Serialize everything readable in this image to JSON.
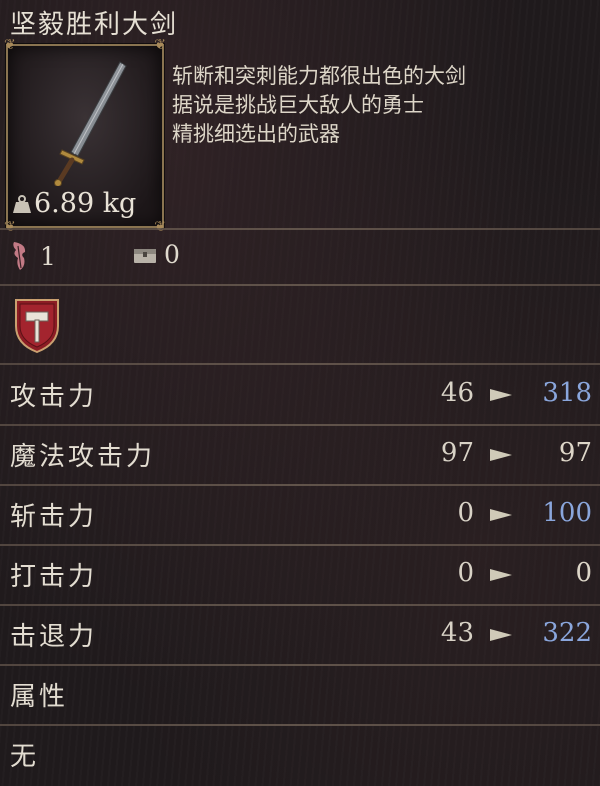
{
  "item": {
    "name": "坚毅胜利大剑",
    "weight": "6.89 kg",
    "description": [
      "斩断和突刺能力都很出色的大剑",
      "据说是挑战巨大敌人的勇士",
      "精挑细选出的武器"
    ]
  },
  "counts": {
    "held": "1",
    "stored": "0"
  },
  "stats": [
    {
      "label": "攻击力",
      "base": "46",
      "new": "318",
      "new_color": "#8aa6dc"
    },
    {
      "label": "魔法攻击力",
      "base": "97",
      "new": "97",
      "new_color": "#ddd6c8"
    },
    {
      "label": "斩击力",
      "base": "0",
      "new": "100",
      "new_color": "#8aa6dc"
    },
    {
      "label": "打击力",
      "base": "0",
      "new": "0",
      "new_color": "#ddd6c8"
    },
    {
      "label": "击退力",
      "base": "43",
      "new": "322",
      "new_color": "#8aa6dc"
    }
  ],
  "attribute": {
    "label": "属性",
    "value": "无"
  },
  "icons": {
    "item": "greatsword-icon",
    "weight": "weight-icon",
    "held": "feather-rune-icon",
    "stored": "chest-icon",
    "badge": "hammer-shield-icon",
    "compare": "arrow-right-icon"
  }
}
